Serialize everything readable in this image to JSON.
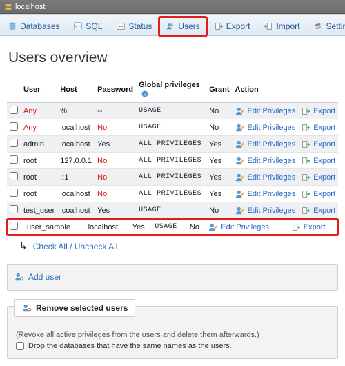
{
  "titlebar": {
    "host": "localhost"
  },
  "tabs": [
    {
      "label": "Databases",
      "icon": "database-icon"
    },
    {
      "label": "SQL",
      "icon": "sql-icon"
    },
    {
      "label": "Status",
      "icon": "status-icon"
    },
    {
      "label": "Users",
      "icon": "users-icon"
    },
    {
      "label": "Export",
      "icon": "export-icon"
    },
    {
      "label": "Import",
      "icon": "import-icon"
    },
    {
      "label": "Settings",
      "icon": "settings-icon"
    }
  ],
  "heading": "Users overview",
  "columns": {
    "user": "User",
    "host": "Host",
    "password": "Password",
    "privileges": "Global privileges",
    "grant": "Grant",
    "action": "Action"
  },
  "rows": [
    {
      "user": "Any",
      "user_red": true,
      "host": "%",
      "password": "--",
      "pw_red": false,
      "priv": "USAGE",
      "grant": "No"
    },
    {
      "user": "Any",
      "user_red": true,
      "host": "localhost",
      "password": "No",
      "pw_red": true,
      "priv": "USAGE",
      "grant": "No"
    },
    {
      "user": "admin",
      "user_red": false,
      "host": "localhost",
      "password": "Yes",
      "pw_red": false,
      "priv": "ALL PRIVILEGES",
      "grant": "Yes"
    },
    {
      "user": "root",
      "user_red": false,
      "host": "127.0.0.1",
      "password": "No",
      "pw_red": true,
      "priv": "ALL PRIVILEGES",
      "grant": "Yes"
    },
    {
      "user": "root",
      "user_red": false,
      "host": "::1",
      "password": "No",
      "pw_red": true,
      "priv": "ALL PRIVILEGES",
      "grant": "Yes"
    },
    {
      "user": "root",
      "user_red": false,
      "host": "localhost",
      "password": "No",
      "pw_red": true,
      "priv": "ALL PRIVILEGES",
      "grant": "Yes"
    },
    {
      "user": "test_user",
      "user_red": false,
      "host": "lcoalhost",
      "password": "Yes",
      "pw_red": false,
      "priv": "USAGE",
      "grant": "No"
    },
    {
      "user": "user_sample",
      "user_red": false,
      "host": "localhost",
      "password": "Yes",
      "pw_red": false,
      "priv": "USAGE",
      "grant": "No"
    }
  ],
  "actions": {
    "edit": "Edit Privileges",
    "export": "Export"
  },
  "checkall": {
    "label": "Check All / Uncheck All"
  },
  "adduser": {
    "label": "Add user"
  },
  "remove": {
    "title": "Remove selected users",
    "hint": "(Revoke all active privileges from the users and delete them afterwards.)",
    "drop_label": "Drop the databases that have the same names as the users."
  },
  "highlight": {
    "tab_index": 3,
    "row_index": 7
  }
}
